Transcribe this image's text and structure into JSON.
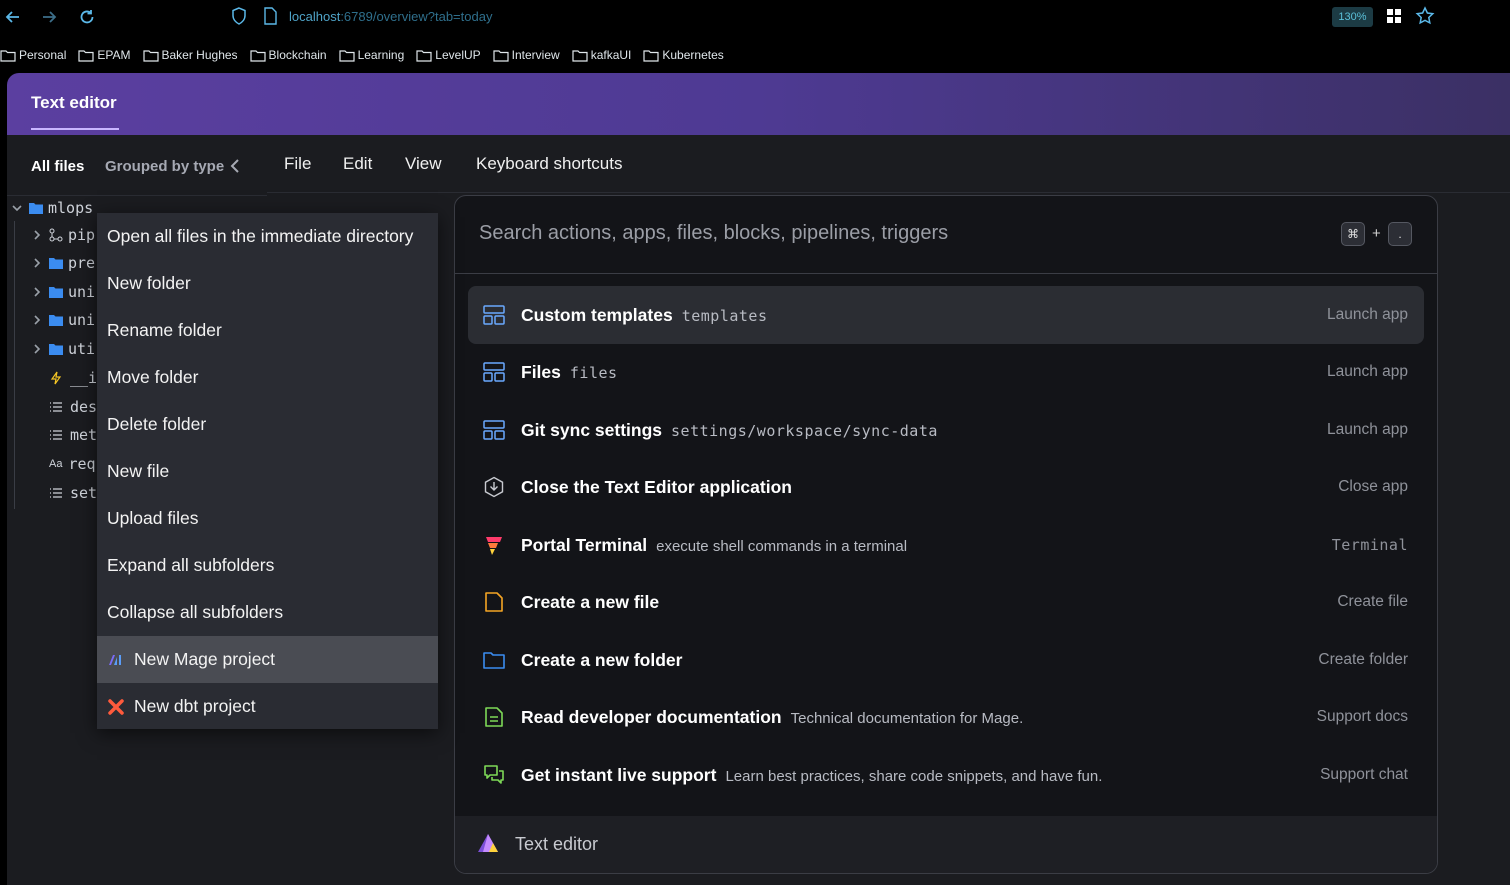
{
  "browser": {
    "url_host": "localhost",
    "url_path": ":6789/overview?tab=today",
    "zoom": "130%"
  },
  "bookmarks": [
    "Personal",
    "EPAM",
    "Baker Hughes",
    "Blockchain",
    "Learning",
    "LevelUP",
    "Interview",
    "kafkaUI",
    "Kubernetes"
  ],
  "app": {
    "title": "Text editor"
  },
  "sidebar": {
    "tab_all": "All files",
    "tab_grouped": "Grouped by type",
    "tree": [
      {
        "label": "mlops"
      },
      {
        "label": "pip"
      },
      {
        "label": "pre"
      },
      {
        "label": "uni"
      },
      {
        "label": "uni"
      },
      {
        "label": "uti"
      },
      {
        "label": "__i"
      },
      {
        "label": "des"
      },
      {
        "label": "met"
      },
      {
        "label": "req"
      },
      {
        "label": "set"
      }
    ]
  },
  "menubar": {
    "items": [
      "File",
      "Edit",
      "View",
      "Keyboard shortcuts"
    ]
  },
  "context_menu": {
    "items": [
      "Open all files in the immediate directory",
      "New folder",
      "Rename folder",
      "Move folder",
      "Delete folder",
      "New file",
      "Upload files",
      "Expand all subfolders",
      "Collapse all subfolders",
      "New Mage project",
      "New dbt project"
    ]
  },
  "command_center": {
    "search_placeholder": "Search actions, apps, files, blocks, pipelines, triggers",
    "shortcut_key1": "⌘",
    "shortcut_plus": "+",
    "shortcut_key2": ".",
    "rows": [
      {
        "title": "Custom templates",
        "desc": "templates",
        "action": "Launch app"
      },
      {
        "title": "Files",
        "desc": "files",
        "action": "Launch app"
      },
      {
        "title": "Git sync settings",
        "desc": "settings/workspace/sync-data",
        "action": "Launch app"
      },
      {
        "title": "Close the Text Editor application",
        "desc": "",
        "action": "Close app"
      },
      {
        "title": "Portal Terminal",
        "desc": "execute shell commands in a terminal",
        "action": "Terminal"
      },
      {
        "title": "Create a new file",
        "desc": "",
        "action": "Create file"
      },
      {
        "title": "Create a new folder",
        "desc": "",
        "action": "Create folder"
      },
      {
        "title": "Read developer documentation",
        "desc": "Technical documentation for Mage.",
        "action": "Support docs"
      },
      {
        "title": "Get instant live support",
        "desc": "Learn best practices, share code snippets, and have fun.",
        "action": "Support chat"
      }
    ],
    "footer_label": "Text editor"
  },
  "colors": {
    "accent_purple": "#5b3fa0",
    "folder_blue": "#3b8cf0",
    "file_orange": "#f5a524",
    "doc_green": "#7ed957"
  }
}
